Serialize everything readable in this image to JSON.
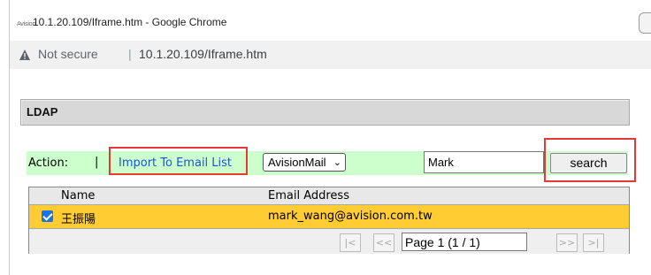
{
  "window": {
    "icon_text": "Avision",
    "title": "10.1.20.109/Iframe.htm - Google Chrome"
  },
  "address_bar": {
    "security_label": "Not secure",
    "separator": "|",
    "url": "10.1.20.109/Iframe.htm"
  },
  "section": {
    "title": "LDAP"
  },
  "action_bar": {
    "label": "Action:",
    "separator": "|",
    "import_link": "Import To Email List",
    "domain_select": {
      "selected": "AvisionMail",
      "chevron": "⌄"
    },
    "search_input": {
      "value": "Mark"
    },
    "search_button": "search"
  },
  "grid": {
    "columns": {
      "name": "Name",
      "email": "Email Address"
    },
    "rows": [
      {
        "checked": true,
        "name": "王振陽",
        "email": "mark_wang@avision.com.tw"
      }
    ]
  },
  "pager": {
    "first": "|<",
    "prev": "<<",
    "page_text": "Page 1 (1 / 1)",
    "next": ">>",
    "last": ">|"
  },
  "colors": {
    "action_bar_bg": "#ccffcc",
    "selected_row_bg": "#ffcc33",
    "highlight_box": "#e53935",
    "link": "#1a53d8"
  }
}
